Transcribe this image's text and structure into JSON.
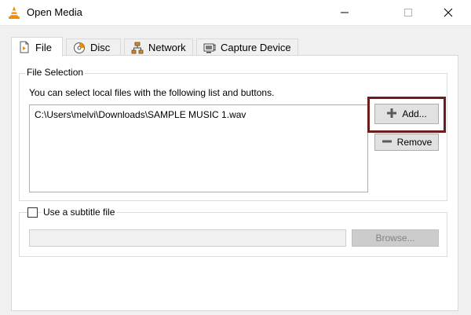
{
  "window": {
    "title": "Open Media",
    "controls": [
      "minimize",
      "maximize",
      "close"
    ]
  },
  "tabs": [
    {
      "label": "File",
      "icon": "file-icon",
      "active": true
    },
    {
      "label": "Disc",
      "icon": "disc-icon",
      "active": false
    },
    {
      "label": "Network",
      "icon": "network-icon",
      "active": false
    },
    {
      "label": "Capture Device",
      "icon": "capture-device-icon",
      "active": false
    }
  ],
  "file_selection": {
    "legend": "File Selection",
    "description": "You can select local files with the following list and buttons.",
    "files": [
      "C:\\Users\\melvi\\Downloads\\SAMPLE MUSIC 1.wav"
    ],
    "add_label": "Add...",
    "remove_label": "Remove"
  },
  "subtitle": {
    "checkbox_label": "Use a subtitle file",
    "checked": false,
    "path_value": "",
    "browse_label": "Browse..."
  },
  "colors": {
    "highlight_border": "#6e1d1d",
    "vlc_orange": "#f28c00"
  }
}
